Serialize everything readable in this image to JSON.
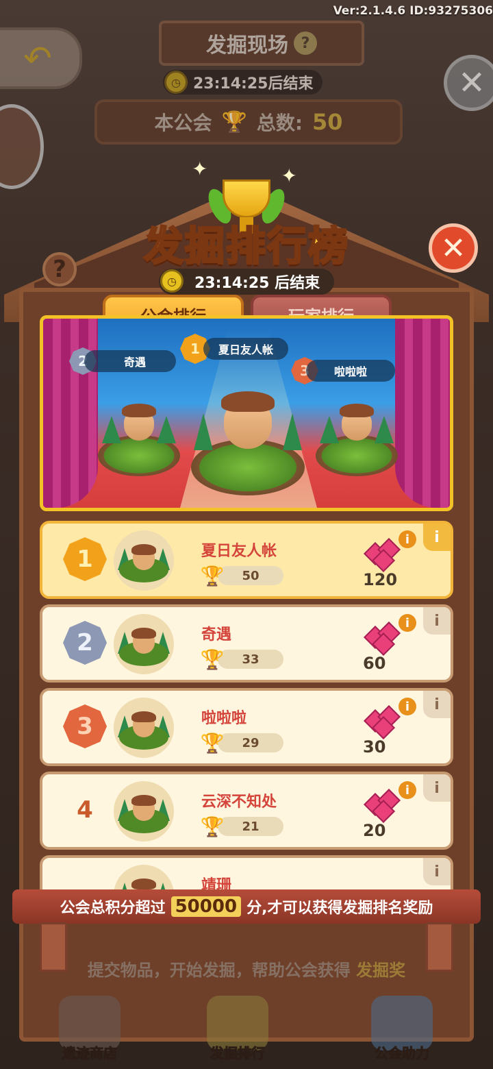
{
  "version": "Ver:2.1.4.6 ID:93275306",
  "background": {
    "title": "发掘现场",
    "timer": "23:14:25后结束",
    "guild_total_label": "本公会",
    "guild_total_suffix": "总数:",
    "guild_total_value": "50"
  },
  "modal": {
    "title": "发掘排行榜",
    "timer": "23:14:25 后结束",
    "tabs": [
      {
        "label": "公会排行",
        "active": true
      },
      {
        "label": "玩家排行",
        "active": false
      }
    ]
  },
  "podium": [
    {
      "rank": "1",
      "name": "夏日友人帐"
    },
    {
      "rank": "2",
      "name": "奇遇"
    },
    {
      "rank": "3",
      "name": "啦啦啦"
    }
  ],
  "rankings": [
    {
      "rank": "1",
      "name": "夏日友人帐",
      "score": "50",
      "reward": "120"
    },
    {
      "rank": "2",
      "name": "奇遇",
      "score": "33",
      "reward": "60"
    },
    {
      "rank": "3",
      "name": "啦啦啦",
      "score": "29",
      "reward": "30"
    },
    {
      "rank": "4",
      "name": "云深不知处",
      "score": "21",
      "reward": "20"
    },
    {
      "rank": "",
      "name": "靖珊",
      "score": "",
      "reward": ""
    }
  ],
  "banner": {
    "prefix": "公会总积分超过",
    "value": "50000",
    "suffix": "分,才可以获得发掘排名奖励"
  },
  "hint": {
    "text": "提交物品，开始发掘，帮助公会获得",
    "highlight": "发掘奖"
  },
  "nav": [
    {
      "label": "遗迹商店"
    },
    {
      "label": "发掘排行"
    },
    {
      "label": "公会助力"
    }
  ],
  "colors": {
    "title_gold": "#ffd33a",
    "accent_red": "#d4443a",
    "gem_pink": "#e9407a"
  }
}
